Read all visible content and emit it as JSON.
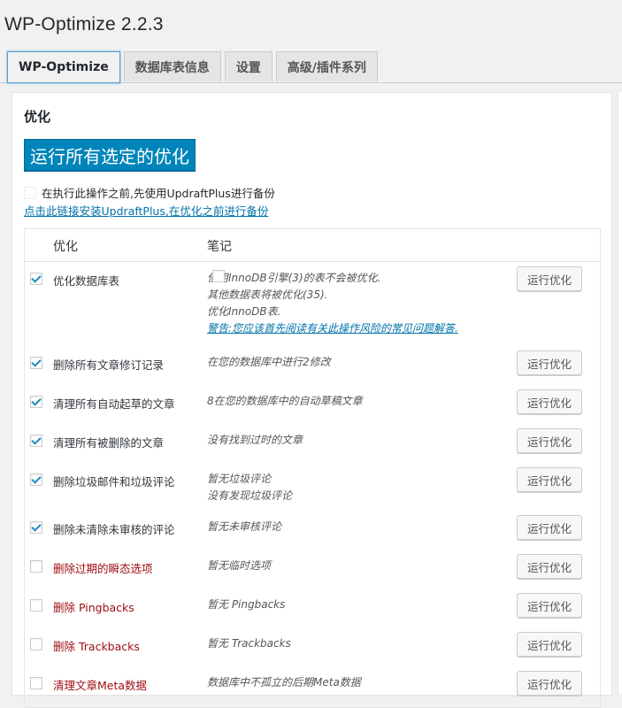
{
  "page": {
    "title": "WP-Optimize 2.2.3"
  },
  "tabs": [
    {
      "label": "WP-Optimize"
    },
    {
      "label": "数据库表信息"
    },
    {
      "label": "设置"
    },
    {
      "label": "高级/插件系列"
    }
  ],
  "panel": {
    "section_title": "优化",
    "run_all_label": "运行所有选定的优化",
    "backup_label": "在执行此操作之前,先使用UpdraftPlus进行备份",
    "backup_link": "点击此链接安装UpdraftPlus,在优化之前进行备份"
  },
  "table": {
    "headers": {
      "optimization": "优化",
      "notes": "笔记"
    },
    "run_label": "运行优化",
    "rows": [
      {
        "label": "优化数据库表",
        "checked": true,
        "warn": false,
        "notes": [
          "使用InnoDB引擎(3)的表不会被优化.",
          "其他数据表将被优化(35)."
        ],
        "inline_checkbox_label": "优化InnoDB表.",
        "faq_link": "警告:您应该首先阅读有关此操作风险的常见问题解答."
      },
      {
        "label": "删除所有文章修订记录",
        "checked": true,
        "warn": false,
        "notes": [
          "在您的数据库中进行2修改"
        ]
      },
      {
        "label": "清理所有自动起草的文章",
        "checked": true,
        "warn": false,
        "notes": [
          "8在您的数据库中的自动草稿文章"
        ]
      },
      {
        "label": "清理所有被删除的文章",
        "checked": true,
        "warn": false,
        "notes": [
          "没有找到过时的文章"
        ]
      },
      {
        "label": "删除垃圾邮件和垃圾评论",
        "checked": true,
        "warn": false,
        "notes": [
          "暂无垃圾评论",
          "没有发现垃圾评论"
        ]
      },
      {
        "label": "删除未清除未审核的评论",
        "checked": true,
        "warn": false,
        "notes": [
          "暂无未审核评论"
        ]
      },
      {
        "label": "删除过期的瞬态选项",
        "checked": false,
        "warn": true,
        "notes": [
          "暂无临时选项"
        ]
      },
      {
        "label": "删除 Pingbacks",
        "checked": false,
        "warn": true,
        "notes": [
          "暂无 Pingbacks"
        ]
      },
      {
        "label": "删除 Trackbacks",
        "checked": false,
        "warn": true,
        "notes": [
          "暂无 Trackbacks"
        ]
      },
      {
        "label": "清理文章Meta数据",
        "checked": false,
        "warn": true,
        "notes": [
          "数据库中不孤立的后期Meta数据"
        ]
      }
    ]
  }
}
